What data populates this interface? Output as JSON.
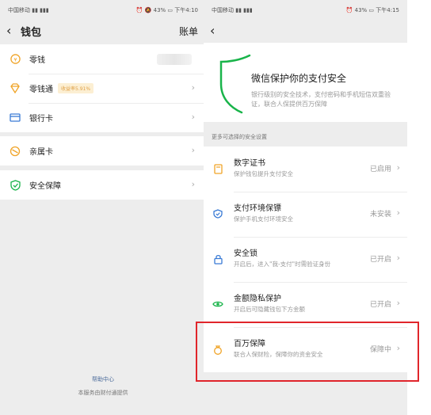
{
  "left": {
    "status": {
      "left": "中国移动 ▮▮ ▮▮▮",
      "right": "⏰ 🔕 43% ▭ 下午4:10"
    },
    "nav": {
      "title": "钱包",
      "right": "账单"
    },
    "items": [
      {
        "label": "零钱",
        "icon": "coin-icon"
      },
      {
        "label": "零钱通",
        "badge": "收益率5.91%",
        "icon": "diamond-icon"
      },
      {
        "label": "银行卡",
        "icon": "card-icon"
      },
      {
        "label": "亲属卡",
        "icon": "family-card-icon"
      },
      {
        "label": "安全保障",
        "icon": "shield-check-icon"
      }
    ],
    "footer_link": "帮助中心",
    "footer_note": "本服务由财付通提供"
  },
  "right": {
    "status": {
      "left": "中国移动 ▮▮ ▮▮▮",
      "right": "⏰ 43% ▭ 下午4:15"
    },
    "hero": {
      "title": "微信保护你的支付安全",
      "desc": "银行级别的安全技术，支付密码和手机短信双重验证，联合人保提供百万保障"
    },
    "section_label": "更多可选择的安全设置",
    "items": [
      {
        "title": "数字证书",
        "desc": "保护钱包提升支付安全",
        "status": "已启用",
        "icon": "certificate-icon"
      },
      {
        "title": "支付环境保镖",
        "desc": "保护手机支付环境安全",
        "status": "未安装",
        "icon": "guard-icon"
      },
      {
        "title": "安全锁",
        "desc": "开启后，进入\"我-支付\"时需验证身份",
        "status": "已开启",
        "icon": "lock-icon"
      },
      {
        "title": "金额隐私保护",
        "desc": "开启后可隐藏钱包下方金额",
        "status": "已开启",
        "icon": "eye-icon"
      },
      {
        "title": "百万保障",
        "desc": "联合人保财险，保障你的资金安全",
        "status": "保障中",
        "icon": "money-bag-icon"
      }
    ]
  },
  "colors": {
    "accent_green": "#19b44a",
    "icon_orange": "#f0a428",
    "icon_blue": "#3a7bd5",
    "highlight_red": "#e0252b"
  }
}
